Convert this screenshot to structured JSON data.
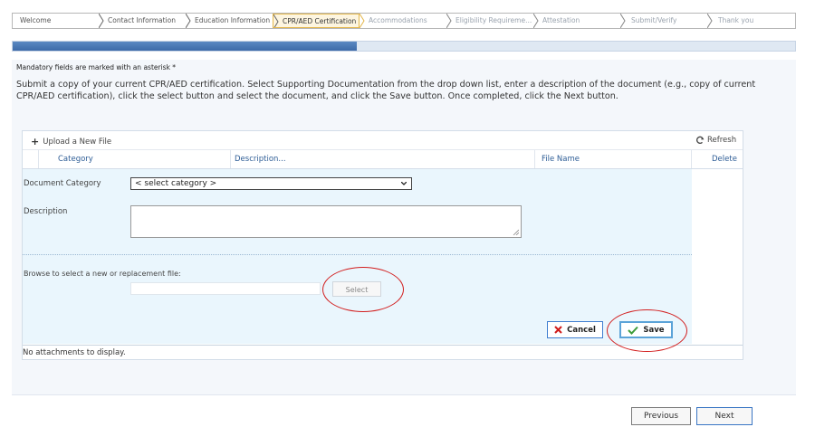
{
  "wizard": {
    "steps": [
      {
        "label": "Welcome"
      },
      {
        "label": "Contact Information"
      },
      {
        "label": "Education Information"
      },
      {
        "label": "CPR/AED Certification"
      },
      {
        "label": "Accommodations"
      },
      {
        "label": "Eligibility Requireme..."
      },
      {
        "label": "Attestation"
      },
      {
        "label": "Submit/Verify"
      },
      {
        "label": "Thank you"
      }
    ],
    "current_index": 3
  },
  "progress": {
    "fraction": 0.44
  },
  "mandatory_note": "Mandatory fields are marked with an asterisk *",
  "instructions": "Submit a copy of your current CPR/AED certification. Select Supporting Documentation from the drop down list, enter a description of the document (e.g., copy of current CPR/AED certification), click the select button and select the document, and click the Save button. Once completed, click the Next button.",
  "grid": {
    "upload_label": "Upload a New File",
    "refresh_label": "Refresh",
    "columns": [
      "Category",
      "Description...",
      "File Name",
      "Delete"
    ],
    "form": {
      "category_label": "Document Category",
      "category_value": "< select category >",
      "description_label": "Description",
      "browse_label": "Browse to select a new or replacement file:",
      "select_button": "Select",
      "cancel_button": "Cancel",
      "save_button": "Save"
    },
    "empty_message": "No attachments to display."
  },
  "nav": {
    "previous": "Previous",
    "next": "Next"
  },
  "colors": {
    "accent": "#3d6aa8",
    "annotation": "#d21e1e",
    "current_step": "#e4b74c"
  }
}
